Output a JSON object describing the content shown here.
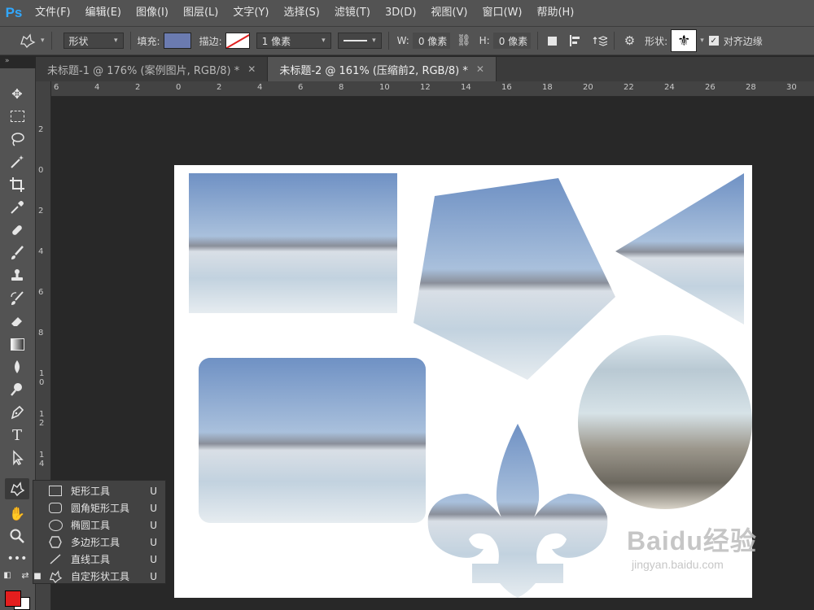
{
  "app": {
    "logo": "Ps"
  },
  "menu": [
    "文件(F)",
    "编辑(E)",
    "图像(I)",
    "图层(L)",
    "文字(Y)",
    "选择(S)",
    "滤镜(T)",
    "3D(D)",
    "视图(V)",
    "窗口(W)",
    "帮助(H)"
  ],
  "options": {
    "tool_icon": "custom-shape-icon",
    "mode_value": "形状",
    "fill_label": "填充:",
    "fill_color": "#6b7bb0",
    "stroke_label": "描边:",
    "stroke_color": "#e02020",
    "stroke_width": "1 像素",
    "w_label": "W:",
    "w_value": "0 像素",
    "link_icon": "link-icon",
    "h_label": "H:",
    "h_value": "0 像素",
    "shape_label": "形状:",
    "shape_icon": "fleur-de-lis-icon",
    "align_edges_label": "对齐边缘",
    "align_edges_checked": true
  },
  "tabs": [
    {
      "label": "未标题-1 @ 176% (案例图片, RGB/8) *",
      "active": false
    },
    {
      "label": "未标题-2 @ 161% (压缩前2, RGB/8) *",
      "active": true
    }
  ],
  "ruler": {
    "horizontal": [
      "6",
      "4",
      "2",
      "0",
      "2",
      "4",
      "6",
      "8",
      "10",
      "12",
      "14",
      "16",
      "18",
      "20",
      "22",
      "24",
      "26",
      "28",
      "30"
    ],
    "vertical": [
      "2",
      "0",
      "2",
      "4",
      "6",
      "8",
      "1 0",
      "1 2",
      "1 4",
      "1 6"
    ]
  },
  "tools": [
    "move-icon",
    "marquee-icon",
    "lasso-icon",
    "magic-wand-icon",
    "crop-icon",
    "eyedropper-icon",
    "healing-brush-icon",
    "brush-icon",
    "clone-stamp-icon",
    "history-brush-icon",
    "eraser-icon",
    "gradient-icon",
    "blur-icon",
    "dodge-icon",
    "pen-icon",
    "type-icon",
    "path-selection-icon",
    "custom-shape-icon",
    "hand-icon",
    "zoom-icon",
    "more-icon"
  ],
  "colors": {
    "foreground": "#e41e1e",
    "background": "#ffffff"
  },
  "shape_menu": [
    {
      "label": "矩形工具",
      "key": "U",
      "icon": "rectangle-icon",
      "selected": false
    },
    {
      "label": "圆角矩形工具",
      "key": "U",
      "icon": "rounded-rectangle-icon",
      "selected": false
    },
    {
      "label": "椭圆工具",
      "key": "U",
      "icon": "ellipse-icon",
      "selected": false
    },
    {
      "label": "多边形工具",
      "key": "U",
      "icon": "polygon-icon",
      "selected": false
    },
    {
      "label": "直线工具",
      "key": "U",
      "icon": "line-icon",
      "selected": false
    },
    {
      "label": "自定形状工具",
      "key": "U",
      "icon": "custom-shape-icon",
      "selected": true
    }
  ],
  "watermark": {
    "brand": "Baidu经验",
    "url": "jingyan.baidu.com"
  }
}
